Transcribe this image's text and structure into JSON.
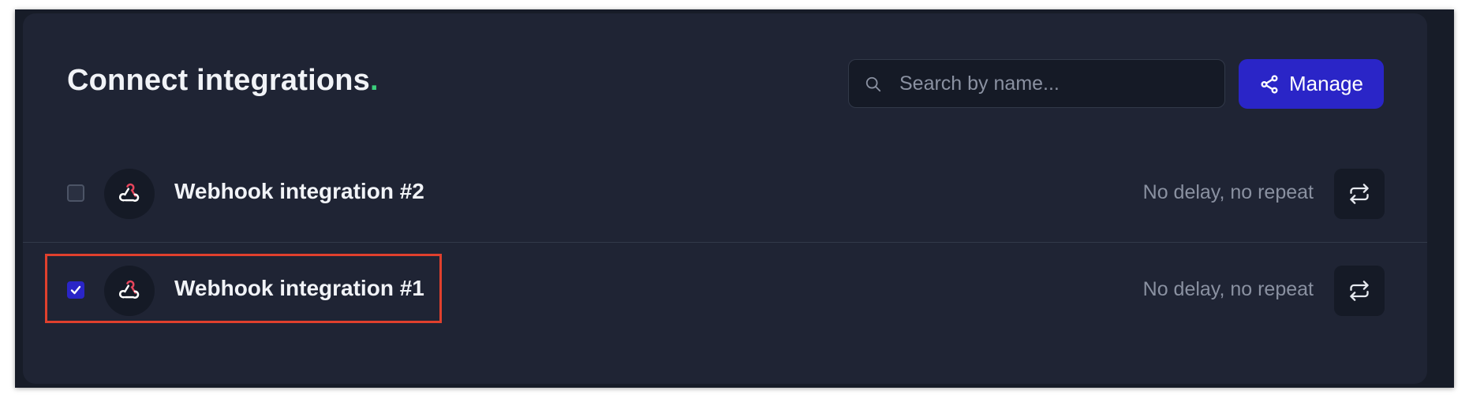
{
  "header": {
    "title": "Connect integrations",
    "title_dot": ".",
    "accent_color": "#3bcf7c"
  },
  "search": {
    "placeholder": "Search by name...",
    "value": "",
    "icon": "search-icon"
  },
  "manage_button": {
    "label": "Manage",
    "icon": "share-nodes-icon",
    "color": "#2a25c7"
  },
  "integrations": [
    {
      "name": "Webhook integration #2",
      "checked": false,
      "schedule": "No delay, no repeat",
      "icon": "webhook-icon",
      "action_icon": "repeat-icon"
    },
    {
      "name": "Webhook integration #1",
      "checked": true,
      "schedule": "No delay, no repeat",
      "icon": "webhook-icon",
      "action_icon": "repeat-icon",
      "highlighted": true
    }
  ],
  "highlight_color": "#e0402d"
}
